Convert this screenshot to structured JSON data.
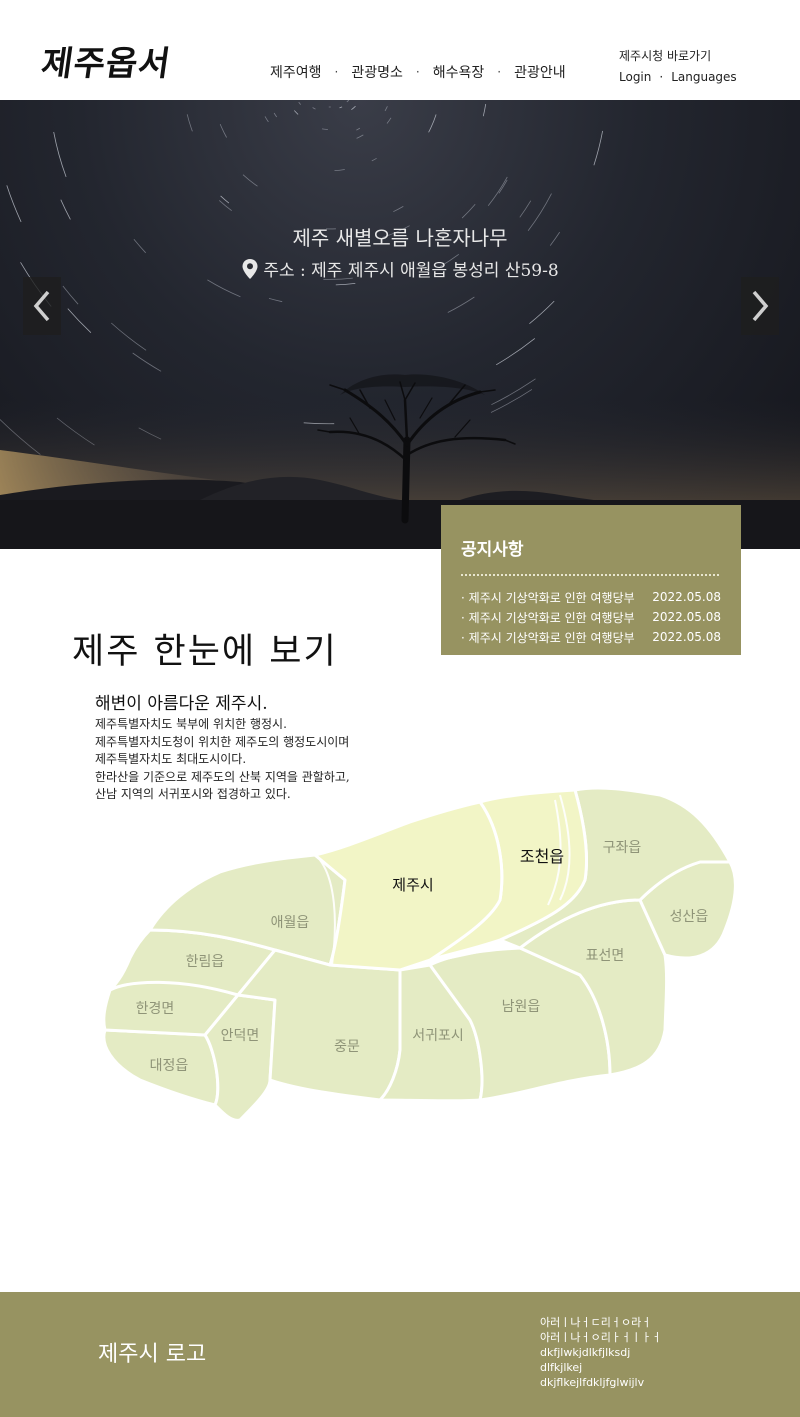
{
  "header": {
    "logo_text": "제주옵서",
    "nav": [
      "제주여행",
      "관광명소",
      "해수욕장",
      "관광안내"
    ],
    "nav_separator": "·",
    "util": {
      "city_link": "제주시청 바로가기",
      "login": "Login",
      "languages": "Languages"
    }
  },
  "hero": {
    "title": "제주 새별오름 나혼자나무",
    "address": "주소 : 제주 제주시 애월읍 봉성리 산59-8",
    "prev_icon": "chevron-left-icon",
    "next_icon": "chevron-right-icon"
  },
  "notice": {
    "title": "공지사항",
    "items": [
      {
        "bullet": "·",
        "title": "제주시 기상악화로 인한 여행당부",
        "date": "2022.05.08"
      },
      {
        "bullet": "·",
        "title": "제주시 기상악화로 인한 여행당부",
        "date": "2022.05.08"
      },
      {
        "bullet": "·",
        "title": "제주시 기상악화로 인한 여행당부",
        "date": "2022.05.08"
      }
    ]
  },
  "overview": {
    "title": "제주 한눈에 보기",
    "subtitle": "해변이 아름다운 제주시.",
    "lines": [
      "제주특별자치도 북부에 위치한 행정시.",
      "제주특별자치도청이 위치한 제주도의 행정도시이며",
      "제주특별자치도 최대도시이다.",
      "한라산을 기준으로 제주도의 산북 지역을 관할하고,",
      "산남 지역의 서귀포시와 접경하고 있다."
    ]
  },
  "map": {
    "regions": {
      "jeju": "제주시",
      "jocheon": "조천읍",
      "gujwa": "구좌읍",
      "seongsan": "성산읍",
      "pyoseon": "표선면",
      "namwon": "남원읍",
      "seogwipo": "서귀포시",
      "jungmun": "중문",
      "andeok": "안덕면",
      "daejeong": "대정읍",
      "hangyeong": "한경면",
      "hallim": "한림읍",
      "aewol": "애월읍"
    },
    "colors": {
      "land": "#e4ebc4",
      "highlight": "#f2f5c6",
      "highlight_label": "#111111",
      "label": "#8f9478"
    }
  },
  "footer": {
    "logo_text": "제주시 로고",
    "info_lines": [
      "아러ㅣ나ㅓㄷ리ㅓㅇ라ㅓ",
      "아러ㅣ나ㅓㅇ리ㅏㅓㅣㅏㅓ",
      "dkfjlwkjdlkfjlksdj",
      "dlfkjlkej",
      "dkjflkejlfdkljfglwijlv"
    ]
  },
  "colors": {
    "accent": "#979361",
    "hero_bg": "#23262f",
    "text": "#222222"
  }
}
